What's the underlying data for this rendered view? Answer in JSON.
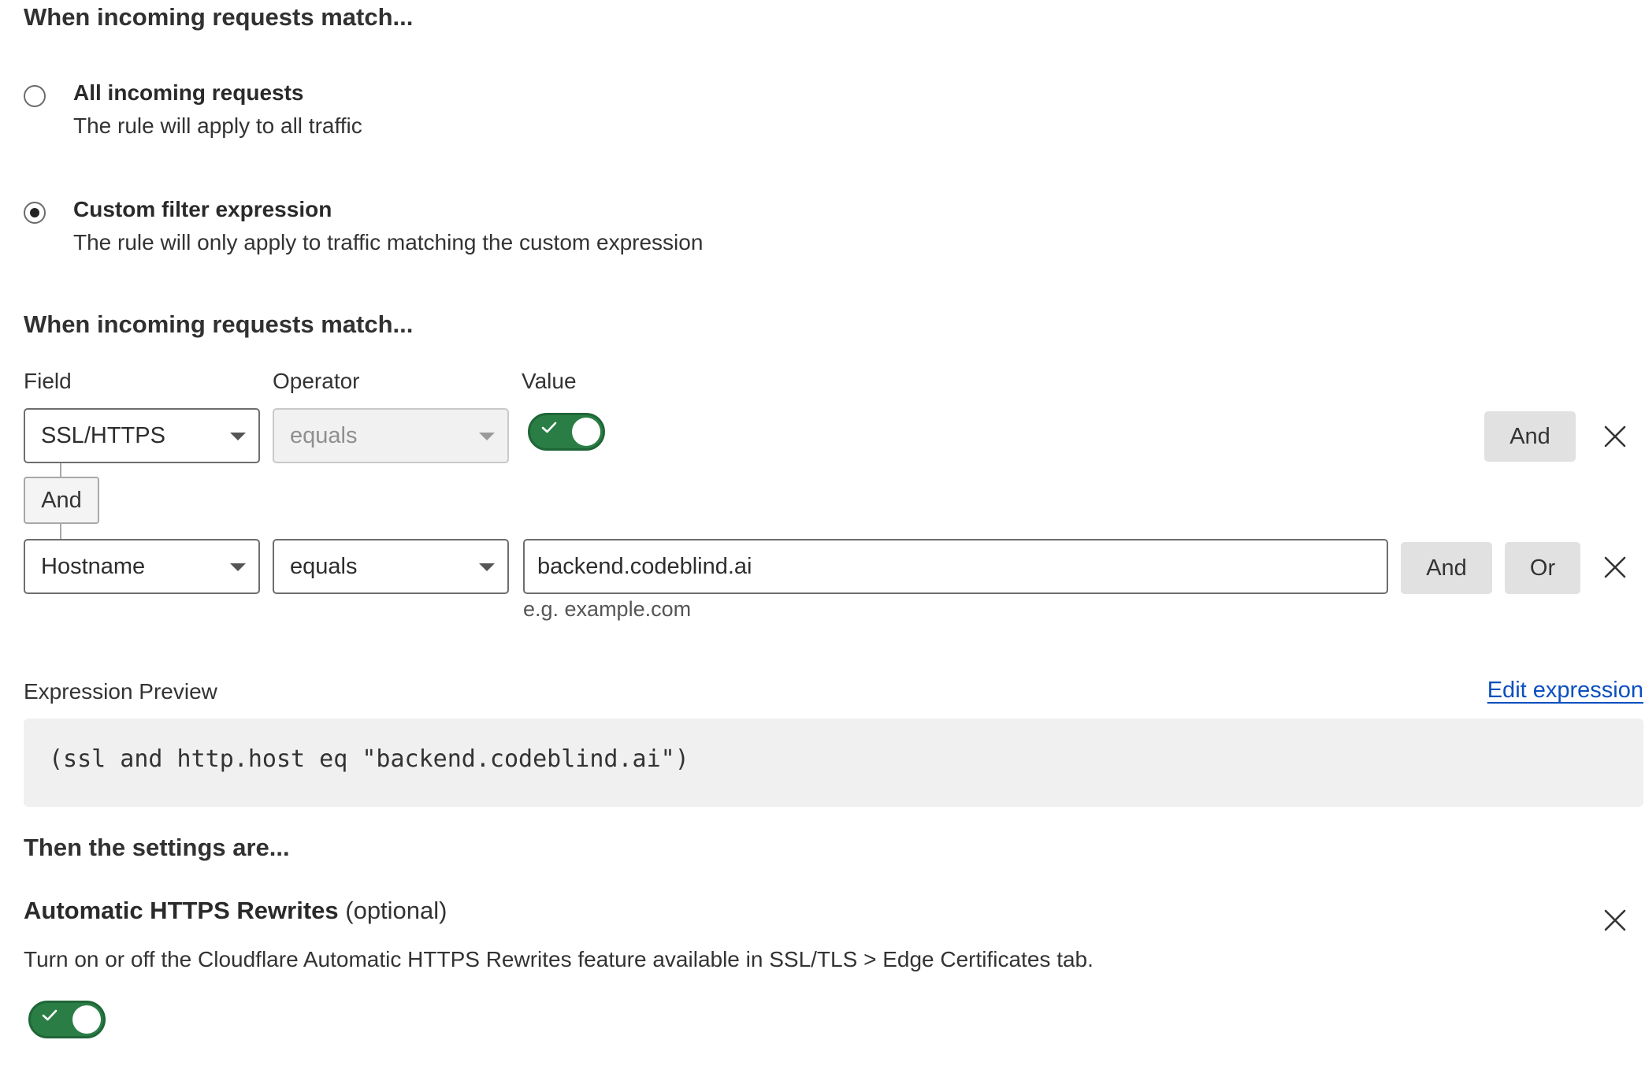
{
  "match_section": {
    "title": "When incoming requests match...",
    "options": [
      {
        "title": "All incoming requests",
        "description": "The rule will apply to all traffic",
        "selected": false
      },
      {
        "title": "Custom filter expression",
        "description": "The rule will only apply to traffic matching the custom expression",
        "selected": true
      }
    ]
  },
  "builder": {
    "title": "When incoming requests match...",
    "column_labels": {
      "field": "Field",
      "operator": "Operator",
      "value": "Value"
    },
    "rows": [
      {
        "field": "SSL/HTTPS",
        "operator": "equals",
        "operator_disabled": true,
        "value_type": "toggle",
        "value_on": true,
        "buttons": [
          "And"
        ]
      },
      {
        "field": "Hostname",
        "operator": "equals",
        "operator_disabled": false,
        "value_type": "text",
        "value": "backend.codeblind.ai",
        "hint": "e.g. example.com",
        "buttons": [
          "And",
          "Or"
        ]
      }
    ],
    "joiner_label": "And"
  },
  "expression_preview": {
    "label": "Expression Preview",
    "edit_link": "Edit expression",
    "expression": "(ssl and http.host eq \"backend.codeblind.ai\")"
  },
  "settings": {
    "title": "Then the settings are...",
    "items": [
      {
        "name": "Automatic HTTPS Rewrites",
        "optional_tag": "(optional)",
        "description": "Turn on or off the Cloudflare Automatic HTTPS Rewrites feature available in SSL/TLS > Edge Certificates tab.",
        "enabled": true
      }
    ]
  },
  "colors": {
    "toggle_on": "#2a7e45",
    "link": "#0b4fbf",
    "code_background": "#f0f0f0",
    "button_grey": "#e1e1e1"
  },
  "icons": {
    "close": "close-icon",
    "dropdown": "chevron-down-icon",
    "toggle_check": "check-icon"
  }
}
